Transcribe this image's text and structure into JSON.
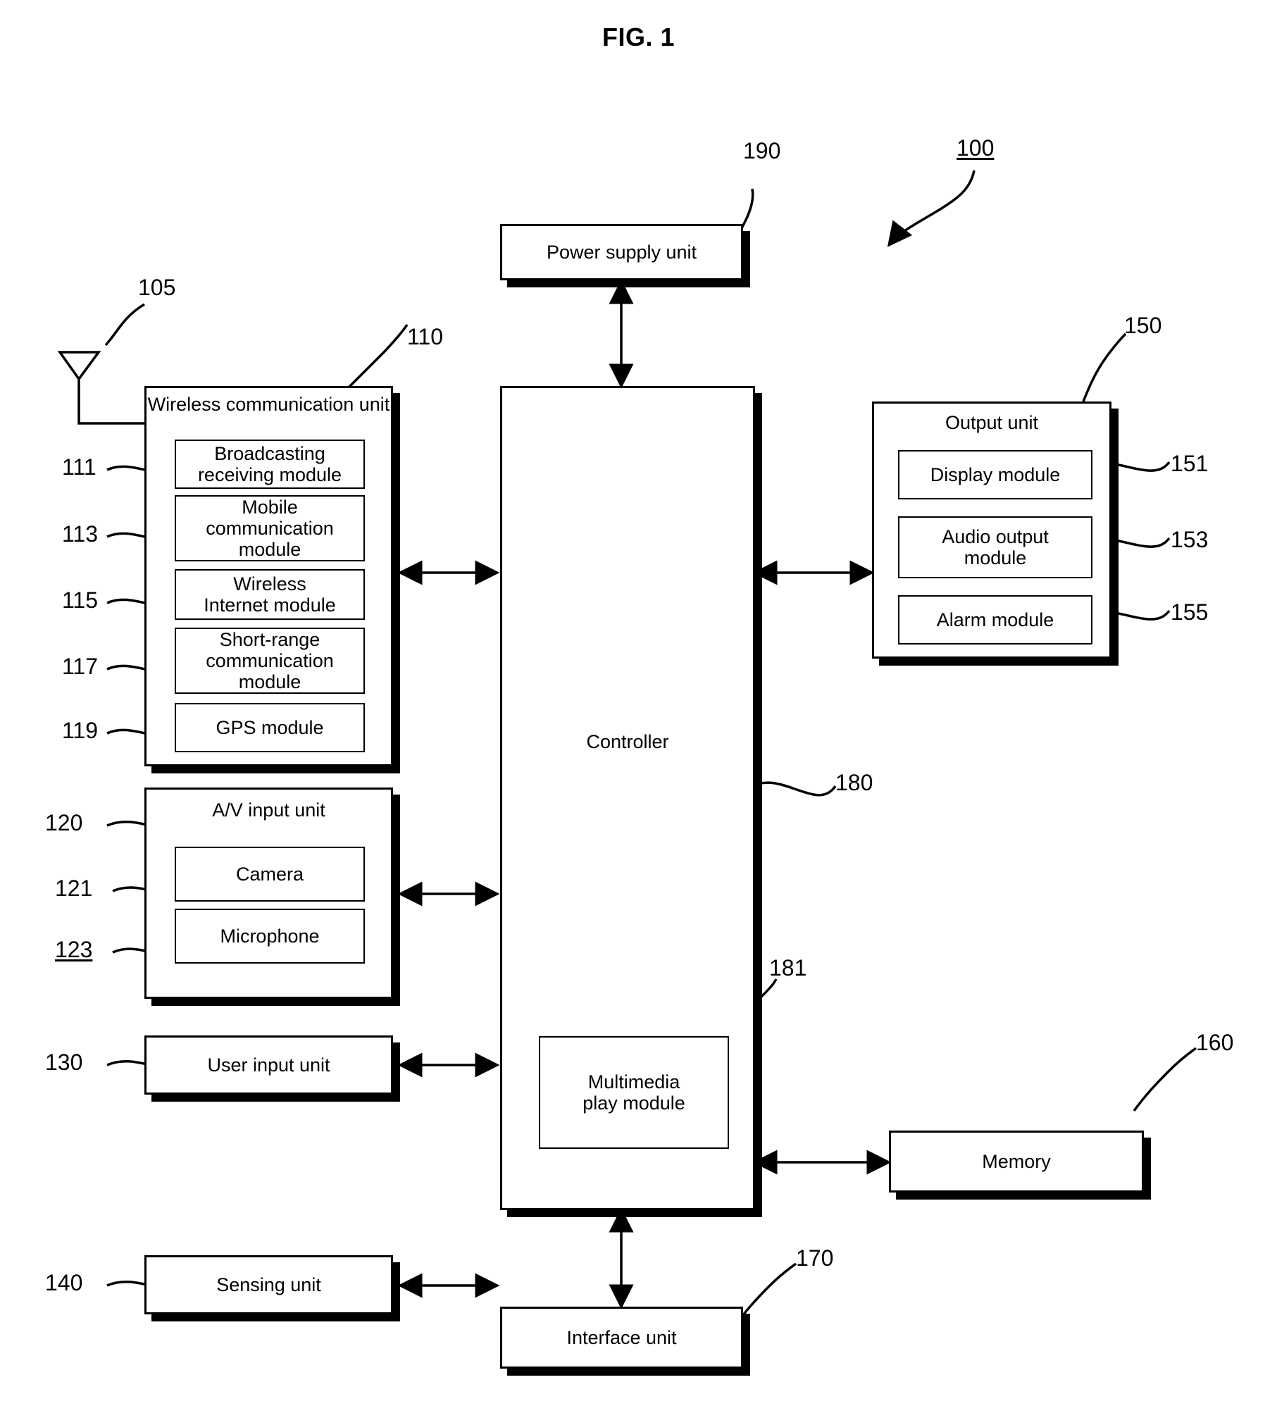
{
  "figure": {
    "title": "FIG. 1",
    "system_ref": "100"
  },
  "blocks": {
    "power_supply": {
      "label": "Power supply unit",
      "ref": "190"
    },
    "wireless_unit": {
      "label": "Wireless\ncommunication unit",
      "ref": "110",
      "antenna_ref": "105",
      "modules": [
        {
          "label": "Broadcasting\nreceiving module",
          "ref": "111"
        },
        {
          "label": "Mobile\ncommunication\nmodule",
          "ref": "113"
        },
        {
          "label": "Wireless\nInternet module",
          "ref": "115"
        },
        {
          "label": "Short-range\ncommunication\nmodule",
          "ref": "117"
        },
        {
          "label": "GPS module",
          "ref": "119"
        }
      ]
    },
    "av_input_unit": {
      "label": "A/V input unit",
      "ref": "120",
      "modules": [
        {
          "label": "Camera",
          "ref": "121",
          "ref_underlined": false
        },
        {
          "label": "Microphone",
          "ref": "123",
          "ref_underlined": true
        }
      ]
    },
    "user_input_unit": {
      "label": "User input unit",
      "ref": "130"
    },
    "sensing_unit": {
      "label": "Sensing unit",
      "ref": "140"
    },
    "controller": {
      "label": "Controller",
      "ref": "180",
      "submodule": {
        "label": "Multimedia\nplay module",
        "ref": "181"
      }
    },
    "output_unit": {
      "label": "Output unit",
      "ref": "150",
      "modules": [
        {
          "label": "Display module",
          "ref": "151"
        },
        {
          "label": "Audio output\nmodule",
          "ref": "153"
        },
        {
          "label": "Alarm module",
          "ref": "155"
        }
      ]
    },
    "memory": {
      "label": "Memory",
      "ref": "160"
    },
    "interface_unit": {
      "label": "Interface unit",
      "ref": "170"
    }
  },
  "colors": {
    "stroke": "#000000",
    "fill": "#ffffff"
  }
}
